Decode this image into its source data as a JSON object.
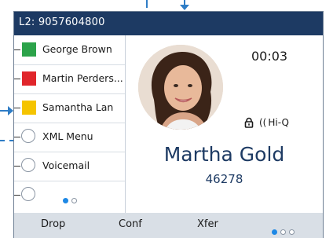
{
  "header": {
    "title": "L2: 9057604800"
  },
  "line_keys": [
    {
      "label": "George Brown",
      "color": "#2ca34a"
    },
    {
      "label": "Martin Perders...",
      "color": "#e0262b"
    },
    {
      "label": "Samantha Lan",
      "color": "#f5c400"
    },
    {
      "label": "XML Menu"
    },
    {
      "label": "Voicemail"
    },
    {
      "label": ""
    }
  ],
  "line_key_pages": {
    "current": 1,
    "total": 2
  },
  "call": {
    "timer": "00:03",
    "security_icon": "lock-icon",
    "audio_label": "Hi-Q",
    "caller_name": "Martha Gold",
    "caller_number": "46278"
  },
  "softkeys": {
    "drop": "Drop",
    "conf": "Conf",
    "xfer": "Xfer",
    "page": {
      "current": 1,
      "total": 3
    }
  },
  "colors": {
    "header": "#1d3a63",
    "accent": "#1e88e5",
    "softkey_bar": "#d9dfe6",
    "callout": "#2f7dc6"
  }
}
